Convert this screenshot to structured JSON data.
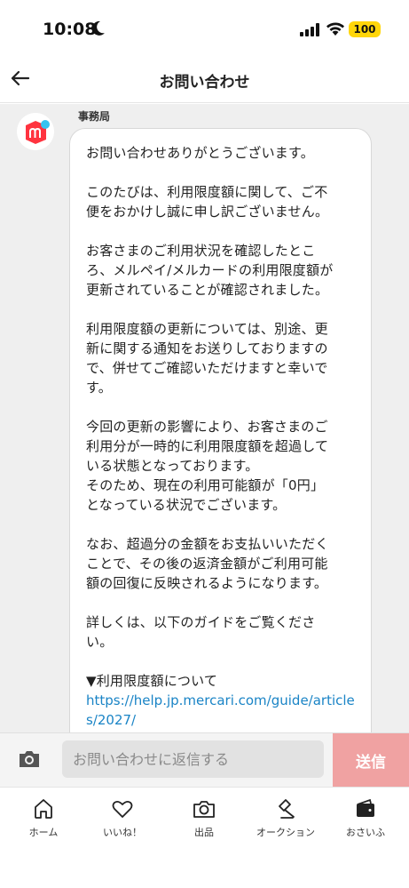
{
  "status": {
    "time": "10:08",
    "battery": "100"
  },
  "header": {
    "title": "お問い合わせ"
  },
  "message": {
    "sender": "事務局",
    "paragraphs": [
      "お問い合わせありがとうございます。",
      "このたびは、利用限度額に関して、ご不\n便をおかけし誠に申し訳ございません。",
      "お客さまのご利用状況を確認したとこ\nろ、メルペイ/メルカードの利用限度額が\n更新されていることが確認されました。",
      "利用限度額の更新については、別途、更\n新に関する通知をお送りしておりますの\nで、併せてご確認いただけますと幸いで\nす。",
      "今回の更新の影響により、お客さまのご\n利用分が一時的に利用限度額を超過して\nいる状態となっております。\nそのため、現在の利用可能額が「0円」\nとなっている状況でございます。",
      "なお、超過分の金額をお支払いいただく\nことで、その後の返済金額がご利用可能\n額の回復に反映されるようになります。",
      "詳しくは、以下のガイドをご覧くださ\nい。"
    ],
    "guide_heading": "▼利用限度額について",
    "guide_link": "https://help.jp.mercari.com/guide/articles/2027/"
  },
  "composer": {
    "placeholder": "お問い合わせに返信する",
    "send_label": "送信"
  },
  "tabbar": {
    "items": [
      {
        "label": "ホーム",
        "icon": "home-icon"
      },
      {
        "label": "いいね！",
        "icon": "heart-icon"
      },
      {
        "label": "出品",
        "icon": "camera-icon"
      },
      {
        "label": "オークション",
        "icon": "gavel-icon"
      },
      {
        "label": "おさいふ",
        "icon": "wallet-icon"
      }
    ]
  },
  "colors": {
    "accent": "#ff333f",
    "send_button": "#f0a2a2",
    "link": "#1a84c6",
    "chat_background": "#efefef"
  }
}
